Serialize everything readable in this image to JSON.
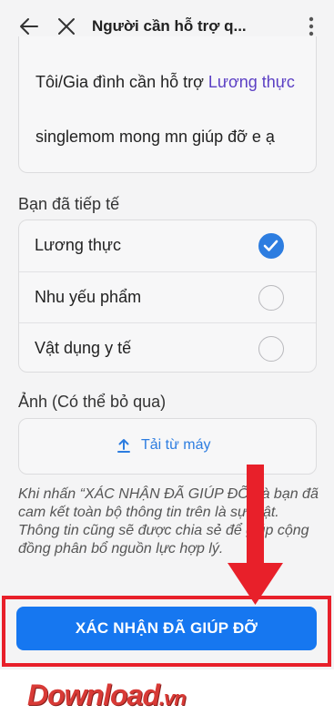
{
  "header": {
    "title": "Người cần hỗ trợ q...",
    "icons": {
      "back": "arrow-left-icon",
      "close": "close-icon",
      "more": "more-vertical-icon"
    }
  },
  "request": {
    "line1_prefix": "Tôi/Gia đình cần hỗ trợ ",
    "line1_link": "Lương thực",
    "line2": "singlemom mong mn giúp đỡ e ạ"
  },
  "supply": {
    "label": "Bạn đã tiếp tế",
    "options": [
      {
        "label": "Lương thực",
        "checked": true
      },
      {
        "label": "Nhu yếu phẩm",
        "checked": false
      },
      {
        "label": "Vật dụng y tế",
        "checked": false
      }
    ]
  },
  "photo": {
    "label": "Ảnh (Có thể bỏ qua)",
    "upload_label": "Tải từ máy",
    "icon": "upload-icon"
  },
  "disclaimer": {
    "line1": "Khi nhấn “XÁC NHẬN ĐÃ GIÚP ĐỠ” là bạn đã cam kết toàn bộ thông tin trên là sự thật.",
    "line2": "Thông tin cũng sẽ được chia sẻ để giúp cộng đồng phân bổ nguồn lực hợp lý."
  },
  "confirm_button": {
    "label": "XÁC NHẬN ĐÃ GIÚP ĐỠ"
  },
  "watermark": {
    "brand": "Download",
    "tld": ".vn"
  },
  "colors": {
    "accent": "#1677f0",
    "link": "#5b3fc4",
    "annotation": "#e8202a"
  }
}
